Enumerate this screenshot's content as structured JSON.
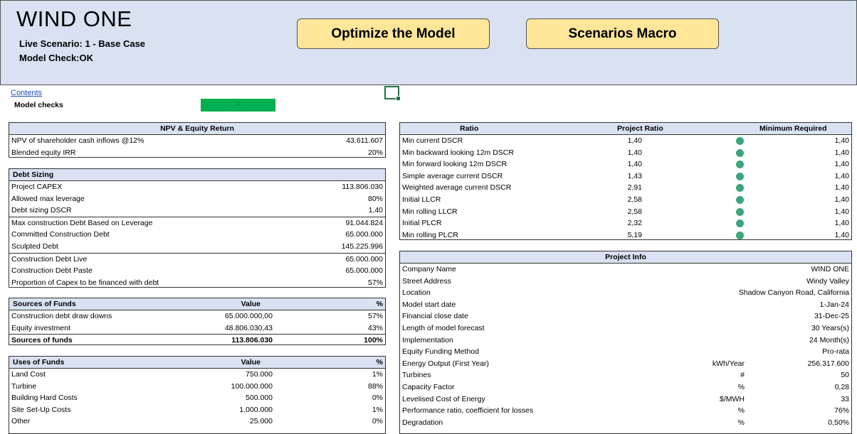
{
  "banner": {
    "title": "WIND ONE",
    "live_scenario": "Live Scenario: 1  -  Base Case",
    "model_check": "Model Check:OK",
    "optimize_button": "Optimize the Model",
    "scenarios_button": "Scenarios Macro"
  },
  "contents_link": "Contents",
  "model_checks": {
    "label": "Model checks",
    "value": "-"
  },
  "npv": {
    "header": "NPV & Equity Return",
    "rows": [
      {
        "label": "NPV of shareholder cash inflows  @12%",
        "value": "43.611.607"
      },
      {
        "label": "Blended equity IRR",
        "value": "20%"
      }
    ]
  },
  "debt": {
    "header": "Debt Sizing",
    "rows": [
      {
        "label": "Project CAPEX",
        "value": "113.806.030"
      },
      {
        "label": "Allowed max leverage",
        "value": "80%"
      },
      {
        "label": "Debt sizing DSCR",
        "value": "1,40"
      },
      {
        "label": "Max construction Debt Based on Leverage",
        "value": "91.044.824"
      },
      {
        "label": "Committed Construction Debt",
        "value": "65.000.000"
      },
      {
        "label": "Sculpted Debt",
        "value": "145.225.996"
      },
      {
        "label": "Construction Debt Live",
        "value": "65.000.000"
      },
      {
        "label": "Construction Debt Paste",
        "value": "65.000.000"
      },
      {
        "label": "Proportion of Capex to be financed with debt",
        "value": "57%"
      }
    ]
  },
  "sources": {
    "header": "Sources of Funds",
    "value_header": "Value",
    "pct_header": "%",
    "rows": [
      {
        "label": "Construction debt draw downs",
        "value": "65.000.000,00",
        "pct": "57%"
      },
      {
        "label": "Equity investment",
        "value": "48.806.030,43",
        "pct": "43%"
      }
    ],
    "total": {
      "label": "Sources of funds",
      "value": "113.806.030",
      "pct": "100%"
    }
  },
  "uses": {
    "header": "Uses of Funds",
    "value_header": "Value",
    "pct_header": "%",
    "rows": [
      {
        "label": "Land Cost",
        "value": "750.000",
        "pct": "1%"
      },
      {
        "label": "Turbine",
        "value": "100.000.000",
        "pct": "88%"
      },
      {
        "label": "Building Hard Costs",
        "value": "500.000",
        "pct": "0%"
      },
      {
        "label": "Site Set-Up Costs",
        "value": "1.000.000",
        "pct": "1%"
      },
      {
        "label": "Other",
        "value": "25.000",
        "pct": "0%"
      }
    ]
  },
  "ratio": {
    "header": "Ratio",
    "project_header": "Project Ratio",
    "min_header": "Minimum Required",
    "status_color": "#3aa77a",
    "rows": [
      {
        "label": "Min current DSCR",
        "project": "1,40",
        "min": "1,40"
      },
      {
        "label": "Min backward looking 12m DSCR",
        "project": "1,40",
        "min": "1,40"
      },
      {
        "label": "Min forward looking 12m DSCR",
        "project": "1,40",
        "min": "1,40"
      },
      {
        "label": "Simple average current DSCR",
        "project": "1,43",
        "min": "1,40"
      },
      {
        "label": "Weighted average current DSCR",
        "project": "2,91",
        "min": "1,40"
      },
      {
        "label": "Initial LLCR",
        "project": "2,58",
        "min": "1,40"
      },
      {
        "label": "Min rolling LLCR",
        "project": "2,58",
        "min": "1,40"
      },
      {
        "label": "Initial PLCR",
        "project": "2,32",
        "min": "1,40"
      },
      {
        "label": "Min rolling PLCR",
        "project": "5,19",
        "min": "1,40"
      }
    ]
  },
  "info": {
    "header": "Project Info",
    "rows": [
      {
        "label": "Company Name",
        "unit": "",
        "value": "WIND ONE"
      },
      {
        "label": "Street Address",
        "unit": "",
        "value": "Windy Valley"
      },
      {
        "label": "Location",
        "unit": "",
        "value": "Shadow Canyon Road, California"
      },
      {
        "label": "Model start date",
        "unit": "",
        "value": "1-Jan-24"
      },
      {
        "label": "Financial close date",
        "unit": "",
        "value": "31-Dec-25"
      },
      {
        "label": "Length of model forecast",
        "unit": "",
        "value": "30 Years(s)"
      },
      {
        "label": "Implementation",
        "unit": "",
        "value": "24 Month(s)"
      },
      {
        "label": "Equity Funding Method",
        "unit": "",
        "value": "Pro-rata"
      },
      {
        "label": "Energy Output (First Year)",
        "unit": "kWh/Year",
        "value": "256.317.600"
      },
      {
        "label": "Turbines",
        "unit": "#",
        "value": "50"
      },
      {
        "label": "Capacity Factor",
        "unit": "%",
        "value": "0,28"
      },
      {
        "label": "Levelised Cost of Energy",
        "unit": "$/MWH",
        "value": "33"
      },
      {
        "label": "Performance ratio, coefficient for losses",
        "unit": "%",
        "value": "76%"
      },
      {
        "label": "Degradation",
        "unit": "%",
        "value": "0,50%"
      }
    ]
  }
}
